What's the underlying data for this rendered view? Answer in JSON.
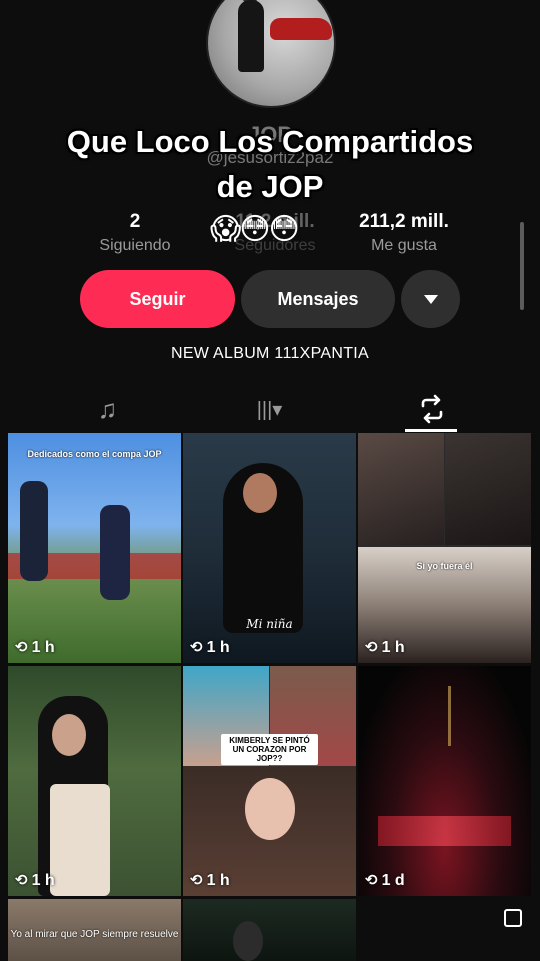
{
  "profile": {
    "username_partial": "JOP",
    "handle_partial": "@jesusortiz2pa2",
    "overlay_title_line1": "Que Loco Los Compartidos",
    "overlay_title_line2": "de JOP",
    "emojis": "😱😳😳"
  },
  "stats": [
    {
      "value": "2",
      "label": "Siguiendo"
    },
    {
      "value": "11,2 mill.",
      "label": "Seguidores"
    },
    {
      "value": "211,2 mill.",
      "label": "Me gusta"
    }
  ],
  "buttons": {
    "follow": "Seguir",
    "messages": "Mensajes"
  },
  "bio": "NEW ALBUM 111XPANTIA",
  "tabs": [
    {
      "name": "music",
      "icon": "♫"
    },
    {
      "name": "collections",
      "icon": "|||▾"
    },
    {
      "name": "reposts",
      "icon": "⟲",
      "active": true
    }
  ],
  "colors": {
    "accent": "#fe2c55",
    "background": "#0d0d0d",
    "button_dark": "#2f2f2f"
  },
  "videos": [
    {
      "caption": "Dedicados como el compa JOP",
      "time": "1 h"
    },
    {
      "caption": "Mi niña",
      "time": "1 h"
    },
    {
      "caption": "Si yo fuera él",
      "time": "1 h"
    },
    {
      "caption": "",
      "time": "1 h"
    },
    {
      "caption": "KIMBERLY SE PINTÓ UN CORAZON POR JOP??",
      "time": "1 h"
    },
    {
      "caption": "",
      "time": "1 d"
    },
    {
      "caption": "Yo al mirar que JOP siempre resuelve",
      "time": ""
    },
    {
      "caption": "",
      "time": ""
    }
  ]
}
